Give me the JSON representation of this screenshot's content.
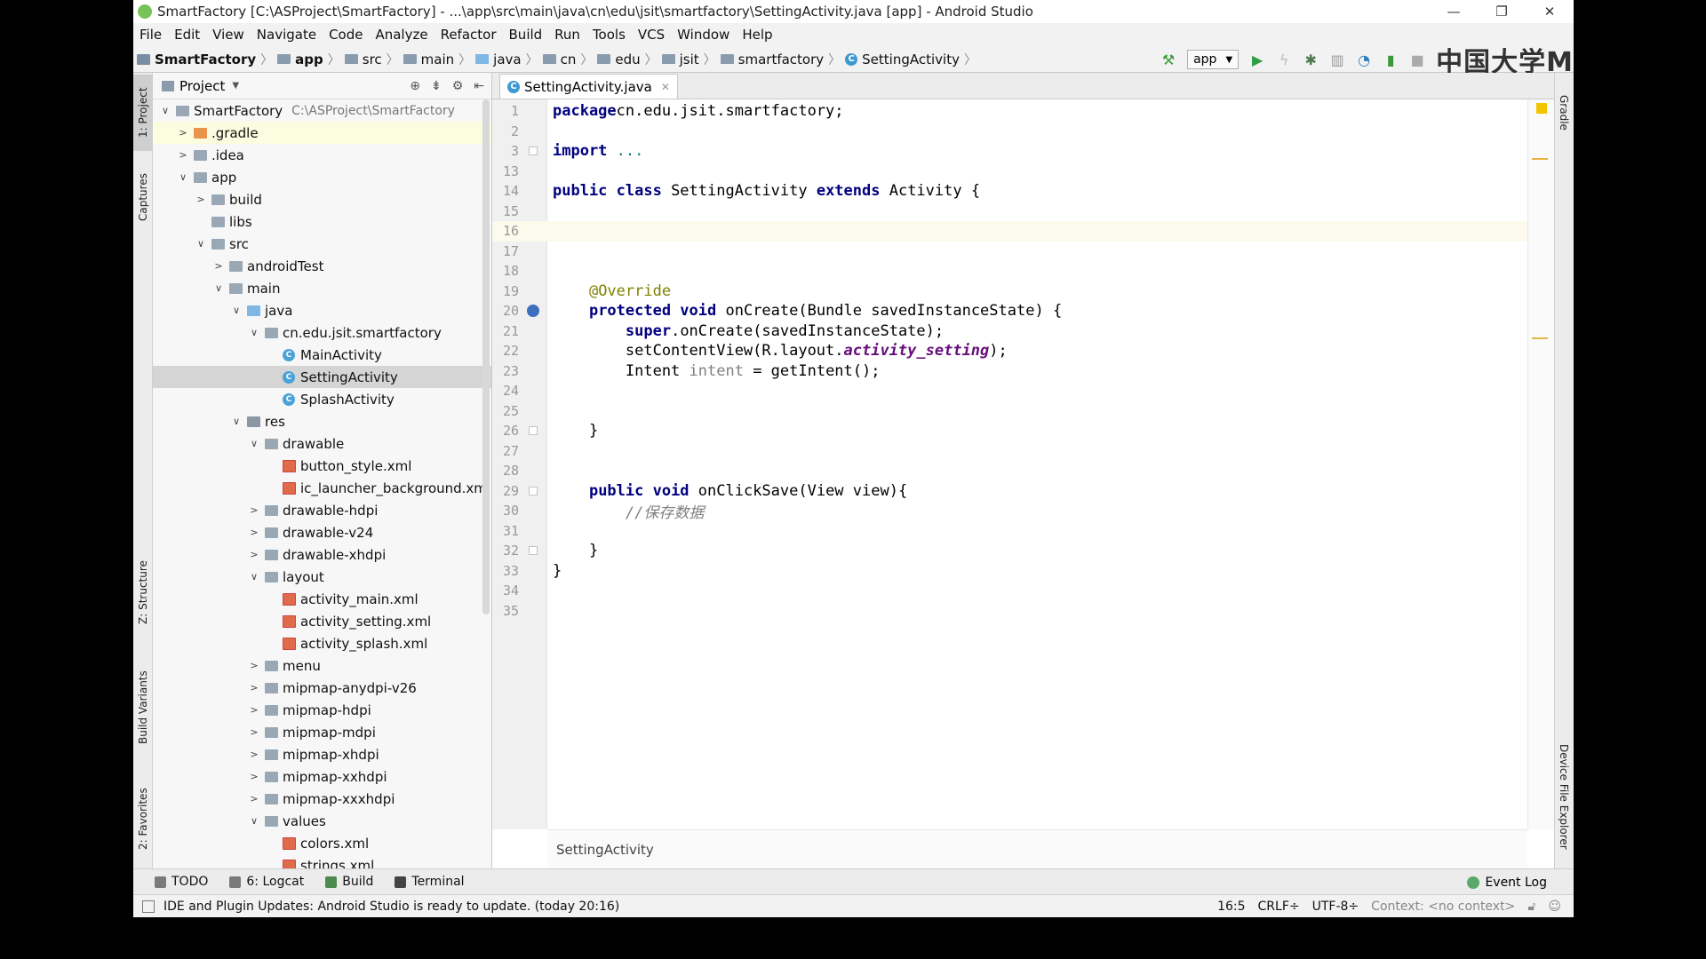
{
  "window": {
    "title": "SmartFactory [C:\\ASProject\\SmartFactory] - ...\\app\\src\\main\\java\\cn\\edu\\jsit\\smartfactory\\SettingActivity.java [app] - Android Studio",
    "minimize": "—",
    "maximize": "❐",
    "close": "✕"
  },
  "menu": [
    "File",
    "Edit",
    "View",
    "Navigate",
    "Code",
    "Analyze",
    "Refactor",
    "Build",
    "Run",
    "Tools",
    "VCS",
    "Window",
    "Help"
  ],
  "breadcrumb": [
    "SmartFactory",
    "app",
    "src",
    "main",
    "java",
    "cn",
    "edu",
    "jsit",
    "smartfactory",
    "SettingActivity"
  ],
  "toolbar": {
    "run_config": "app",
    "watermark": "中国大学M"
  },
  "left_tabs": [
    "1: Project",
    "Captures",
    "Z: Structure",
    "Build Variants",
    "2: Favorites"
  ],
  "right_tabs": [
    "Gradle",
    "Device File Explorer"
  ],
  "project_panel": {
    "title": "Project",
    "tree": [
      {
        "label": "SmartFactory",
        "hint": "C:\\ASProject\\SmartFactory",
        "depth": 0,
        "arrow": "down",
        "icon": "project"
      },
      {
        "label": ".gradle",
        "depth": 1,
        "arrow": "right",
        "icon": "orange"
      },
      {
        "label": ".idea",
        "depth": 1,
        "arrow": "right",
        "icon": "folder"
      },
      {
        "label": "app",
        "depth": 1,
        "arrow": "down",
        "icon": "folder"
      },
      {
        "label": "build",
        "depth": 2,
        "arrow": "right",
        "icon": "folder"
      },
      {
        "label": "libs",
        "depth": 2,
        "arrow": "",
        "icon": "folder"
      },
      {
        "label": "src",
        "depth": 2,
        "arrow": "down",
        "icon": "folder"
      },
      {
        "label": "androidTest",
        "depth": 3,
        "arrow": "right",
        "icon": "folder"
      },
      {
        "label": "main",
        "depth": 3,
        "arrow": "down",
        "icon": "folder"
      },
      {
        "label": "java",
        "depth": 4,
        "arrow": "down",
        "icon": "blue"
      },
      {
        "label": "cn.edu.jsit.smartfactory",
        "depth": 5,
        "arrow": "down",
        "icon": "folder"
      },
      {
        "label": "MainActivity",
        "depth": 6,
        "arrow": "",
        "icon": "class"
      },
      {
        "label": "SettingActivity",
        "depth": 6,
        "arrow": "",
        "icon": "class",
        "selected": true
      },
      {
        "label": "SplashActivity",
        "depth": 6,
        "arrow": "",
        "icon": "class"
      },
      {
        "label": "res",
        "depth": 4,
        "arrow": "down",
        "icon": "res"
      },
      {
        "label": "drawable",
        "depth": 5,
        "arrow": "down",
        "icon": "folder"
      },
      {
        "label": "button_style.xml",
        "depth": 6,
        "arrow": "",
        "icon": "xml"
      },
      {
        "label": "ic_launcher_background.xml",
        "depth": 6,
        "arrow": "",
        "icon": "xml"
      },
      {
        "label": "drawable-hdpi",
        "depth": 5,
        "arrow": "right",
        "icon": "folder"
      },
      {
        "label": "drawable-v24",
        "depth": 5,
        "arrow": "right",
        "icon": "folder"
      },
      {
        "label": "drawable-xhdpi",
        "depth": 5,
        "arrow": "right",
        "icon": "folder"
      },
      {
        "label": "layout",
        "depth": 5,
        "arrow": "down",
        "icon": "folder"
      },
      {
        "label": "activity_main.xml",
        "depth": 6,
        "arrow": "",
        "icon": "xml"
      },
      {
        "label": "activity_setting.xml",
        "depth": 6,
        "arrow": "",
        "icon": "xml"
      },
      {
        "label": "activity_splash.xml",
        "depth": 6,
        "arrow": "",
        "icon": "xml"
      },
      {
        "label": "menu",
        "depth": 5,
        "arrow": "right",
        "icon": "folder"
      },
      {
        "label": "mipmap-anydpi-v26",
        "depth": 5,
        "arrow": "right",
        "icon": "folder"
      },
      {
        "label": "mipmap-hdpi",
        "depth": 5,
        "arrow": "right",
        "icon": "folder"
      },
      {
        "label": "mipmap-mdpi",
        "depth": 5,
        "arrow": "right",
        "icon": "folder"
      },
      {
        "label": "mipmap-xhdpi",
        "depth": 5,
        "arrow": "right",
        "icon": "folder"
      },
      {
        "label": "mipmap-xxhdpi",
        "depth": 5,
        "arrow": "right",
        "icon": "folder"
      },
      {
        "label": "mipmap-xxxhdpi",
        "depth": 5,
        "arrow": "right",
        "icon": "folder"
      },
      {
        "label": "values",
        "depth": 5,
        "arrow": "down",
        "icon": "folder"
      },
      {
        "label": "colors.xml",
        "depth": 6,
        "arrow": "",
        "icon": "xml"
      },
      {
        "label": "strings.xml",
        "depth": 6,
        "arrow": "",
        "icon": "xml"
      }
    ]
  },
  "editor": {
    "tab": "SettingActivity.java",
    "footer": "SettingActivity",
    "lines": [
      {
        "n": "1",
        "tokens": [
          [
            "kw",
            "package"
          ],
          [
            "",
            "cn.edu.jsit.smartfactory;"
          ]
        ]
      },
      {
        "n": "2",
        "tokens": []
      },
      {
        "n": "3",
        "fold": true,
        "tokens": [
          [
            "kw",
            "import"
          ],
          [
            "",
            " "
          ],
          [
            "fold-txt",
            "..."
          ]
        ]
      },
      {
        "n": "13",
        "tokens": []
      },
      {
        "n": "14",
        "tokens": [
          [
            "kw",
            "public class"
          ],
          [
            "",
            " SettingActivity "
          ],
          [
            "kw",
            "extends"
          ],
          [
            "",
            " Activity {"
          ]
        ]
      },
      {
        "n": "15",
        "tokens": []
      },
      {
        "n": "16",
        "current": true,
        "tokens": []
      },
      {
        "n": "17",
        "tokens": []
      },
      {
        "n": "18",
        "tokens": []
      },
      {
        "n": "19",
        "tokens": [
          [
            "",
            "    "
          ],
          [
            "ann",
            "@Override"
          ]
        ]
      },
      {
        "n": "20",
        "override": true,
        "fold": true,
        "tokens": [
          [
            "",
            "    "
          ],
          [
            "kw",
            "protected void"
          ],
          [
            "",
            " onCreate(Bundle savedInstanceState) {"
          ]
        ]
      },
      {
        "n": "21",
        "tokens": [
          [
            "",
            "        "
          ],
          [
            "kw",
            "super"
          ],
          [
            "",
            ".onCreate(savedInstanceState);"
          ]
        ]
      },
      {
        "n": "22",
        "tokens": [
          [
            "",
            "        setContentView(R.layout."
          ],
          [
            "it",
            "activity_setting"
          ],
          [
            "",
            ");"
          ]
        ]
      },
      {
        "n": "23",
        "tokens": [
          [
            "",
            "        Intent "
          ],
          [
            "grey",
            "intent"
          ],
          [
            "",
            " = getIntent();"
          ]
        ]
      },
      {
        "n": "24",
        "tokens": []
      },
      {
        "n": "25",
        "tokens": []
      },
      {
        "n": "26",
        "fold": true,
        "tokens": [
          [
            "",
            "    }"
          ]
        ]
      },
      {
        "n": "27",
        "tokens": []
      },
      {
        "n": "28",
        "tokens": []
      },
      {
        "n": "29",
        "fold": true,
        "tokens": [
          [
            "",
            "    "
          ],
          [
            "kw",
            "public void"
          ],
          [
            "",
            " onClickSave(View view){"
          ]
        ]
      },
      {
        "n": "30",
        "tokens": [
          [
            "",
            "        "
          ],
          [
            "cmt",
            "//保存数据"
          ]
        ]
      },
      {
        "n": "31",
        "tokens": []
      },
      {
        "n": "32",
        "fold": true,
        "tokens": [
          [
            "",
            "    }"
          ]
        ]
      },
      {
        "n": "33",
        "tokens": [
          [
            "",
            "}"
          ]
        ]
      },
      {
        "n": "34",
        "tokens": []
      },
      {
        "n": "35",
        "tokens": []
      }
    ]
  },
  "bottom_tools": [
    "TODO",
    "6: Logcat",
    "Build",
    "Terminal"
  ],
  "event_log": "Event Log",
  "status": {
    "message": "IDE and Plugin Updates: Android Studio is ready to update. (today 20:16)",
    "position": "16:5",
    "line_sep": "CRLF÷",
    "encoding": "UTF-8÷",
    "context": "Context: <no context>"
  }
}
